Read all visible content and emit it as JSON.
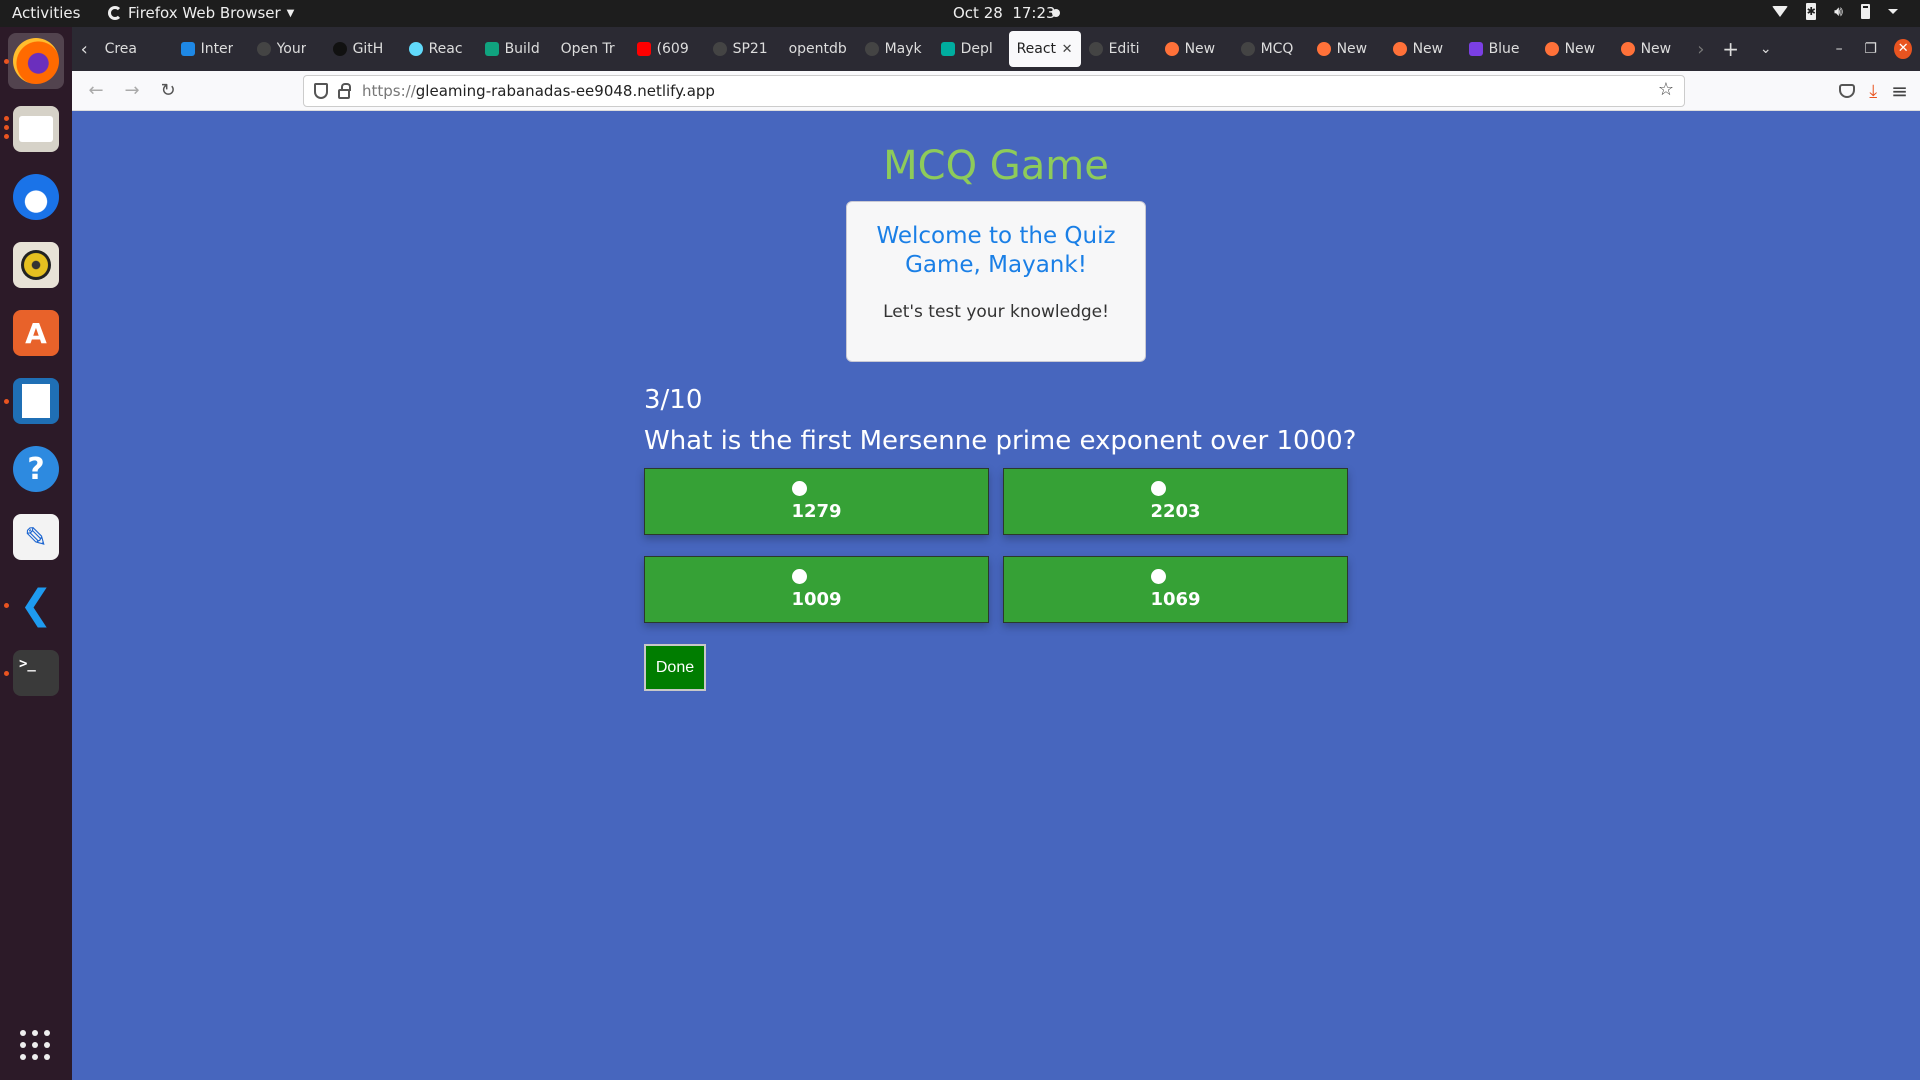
{
  "topbar": {
    "activities": "Activities",
    "app_name": "Firefox Web Browser",
    "date": "Oct 28",
    "time": "17:23"
  },
  "dock": {
    "items": [
      {
        "name": "firefox",
        "running": true,
        "active": true
      },
      {
        "name": "files",
        "running": true
      },
      {
        "name": "thunderbird",
        "running": false
      },
      {
        "name": "rhythmbox",
        "running": false
      },
      {
        "name": "ubuntu-software",
        "running": false
      },
      {
        "name": "libreoffice-writer",
        "running": true
      },
      {
        "name": "help",
        "running": false
      },
      {
        "name": "text-editor",
        "running": false
      },
      {
        "name": "vscode",
        "running": true
      },
      {
        "name": "terminal",
        "running": true
      }
    ],
    "terminal_glyph": ">_",
    "help_glyph": "?",
    "software_glyph": "A",
    "editor_glyph": "✎",
    "vscode_glyph": "❮"
  },
  "browser": {
    "tabs": [
      {
        "title": "Crea",
        "icon": "none"
      },
      {
        "title": "Inter",
        "icon": "is-icon",
        "color": "#1e88e5"
      },
      {
        "title": "Your",
        "icon": "github-icon",
        "color": "#444444"
      },
      {
        "title": "GitH",
        "icon": "github-icon",
        "color": "#111111"
      },
      {
        "title": "Reac",
        "icon": "react-icon",
        "color": "#61dafb"
      },
      {
        "title": "Build",
        "icon": "chatgpt-icon",
        "color": "#10a37f"
      },
      {
        "title": "Open Tr",
        "icon": "none"
      },
      {
        "title": "(609",
        "icon": "youtube-icon",
        "color": "#ff0000"
      },
      {
        "title": "SP21",
        "icon": "github-icon",
        "color": "#444444"
      },
      {
        "title": "opentdb",
        "icon": "none"
      },
      {
        "title": "Mayk",
        "icon": "github-icon",
        "color": "#444444"
      },
      {
        "title": "Depl",
        "icon": "netlify-icon",
        "color": "#00ad9f"
      },
      {
        "title": "React",
        "icon": "none",
        "selected": true
      },
      {
        "title": "Editi",
        "icon": "github-icon",
        "color": "#444444"
      },
      {
        "title": "New",
        "icon": "firefox-icon",
        "color": "#ff7139"
      },
      {
        "title": "MCQ",
        "icon": "github-icon",
        "color": "#444444"
      },
      {
        "title": "New",
        "icon": "firefox-icon",
        "color": "#ff7139"
      },
      {
        "title": "New",
        "icon": "firefox-icon",
        "color": "#ff7139"
      },
      {
        "title": "Blue",
        "icon": "rainbow-icon",
        "color": "#7b3fe4"
      },
      {
        "title": "New",
        "icon": "firefox-icon",
        "color": "#ff7139"
      },
      {
        "title": "New",
        "icon": "firefox-icon",
        "color": "#ff7139"
      }
    ],
    "url_scheme": "https://",
    "url_host": "gleaming-rabanadas-ee9048.netlify.app"
  },
  "page": {
    "title": "MCQ Game",
    "welcome_heading": "Welcome to the Quiz Game, Mayank!",
    "welcome_subtext": "Let's test your knowledge!",
    "progress": "3/10",
    "question": "What is the first Mersenne prime exponent over 1000?",
    "options": [
      "1279",
      "2203",
      "1009",
      "1069"
    ],
    "done_label": "Done"
  },
  "colors": {
    "page_bg": "#4766be",
    "title": "#8ecb5a",
    "welcome_heading": "#1a7fe6",
    "option_bg": "#36a136",
    "done_bg": "#007d00",
    "accent_orange": "#e95420"
  }
}
